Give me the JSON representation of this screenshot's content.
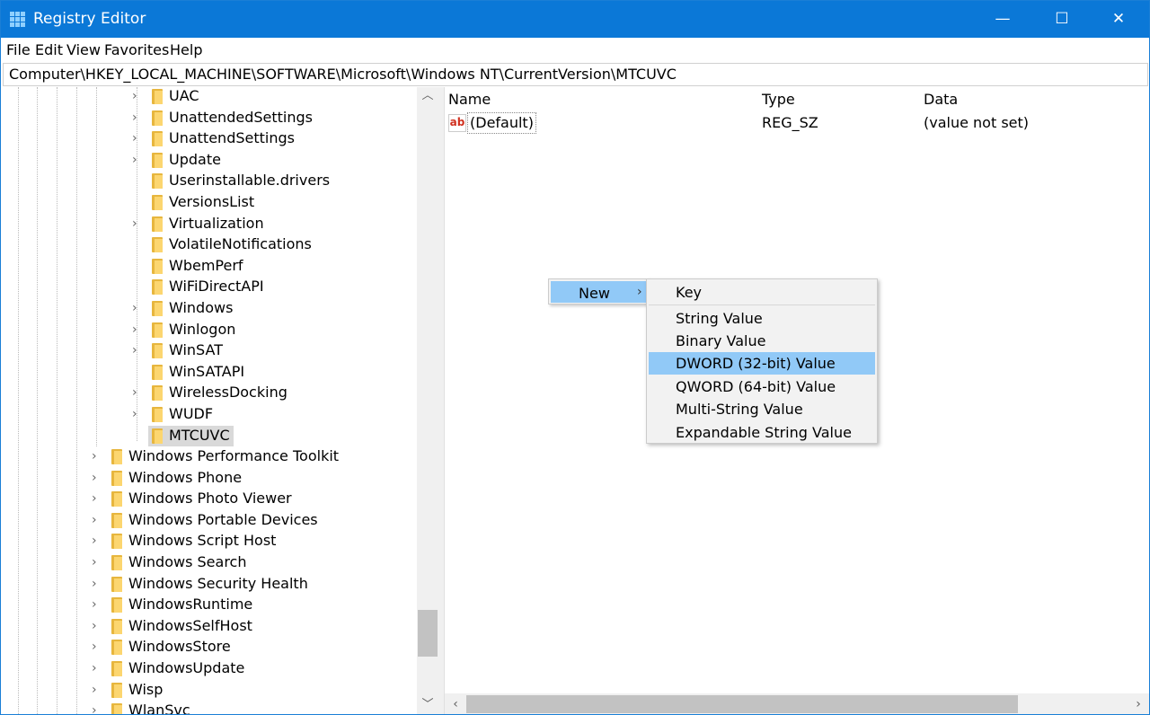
{
  "window": {
    "title": "Registry Editor",
    "minimize": "—",
    "maximize": "☐",
    "close": "✕"
  },
  "menu": [
    "File",
    "Edit",
    "View",
    "Favorites",
    "Help"
  ],
  "address": "Computer\\HKEY_LOCAL_MACHINE\\SOFTWARE\\Microsoft\\Windows NT\\CurrentVersion\\MTCUVC",
  "tree": {
    "sub_items": [
      {
        "label": "UAC",
        "expandable": true
      },
      {
        "label": "UnattendedSettings",
        "expandable": true
      },
      {
        "label": "UnattendSettings",
        "expandable": true
      },
      {
        "label": "Update",
        "expandable": true
      },
      {
        "label": "Userinstallable.drivers",
        "expandable": false
      },
      {
        "label": "VersionsList",
        "expandable": false
      },
      {
        "label": "Virtualization",
        "expandable": true
      },
      {
        "label": "VolatileNotifications",
        "expandable": false
      },
      {
        "label": "WbemPerf",
        "expandable": false
      },
      {
        "label": "WiFiDirectAPI",
        "expandable": false
      },
      {
        "label": "Windows",
        "expandable": true
      },
      {
        "label": "Winlogon",
        "expandable": true
      },
      {
        "label": "WinSAT",
        "expandable": true
      },
      {
        "label": "WinSATAPI",
        "expandable": false
      },
      {
        "label": "WirelessDocking",
        "expandable": true
      },
      {
        "label": "WUDF",
        "expandable": true
      },
      {
        "label": "MTCUVC",
        "expandable": false,
        "selected": true
      }
    ],
    "top_items": [
      {
        "label": "Windows Performance Toolkit",
        "expandable": true
      },
      {
        "label": "Windows Phone",
        "expandable": true
      },
      {
        "label": "Windows Photo Viewer",
        "expandable": true
      },
      {
        "label": "Windows Portable Devices",
        "expandable": true
      },
      {
        "label": "Windows Script Host",
        "expandable": true
      },
      {
        "label": "Windows Search",
        "expandable": true
      },
      {
        "label": "Windows Security Health",
        "expandable": true
      },
      {
        "label": "WindowsRuntime",
        "expandable": true
      },
      {
        "label": "WindowsSelfHost",
        "expandable": true
      },
      {
        "label": "WindowsStore",
        "expandable": true
      },
      {
        "label": "WindowsUpdate",
        "expandable": true
      },
      {
        "label": "Wisp",
        "expandable": true
      },
      {
        "label": "WlanSvc",
        "expandable": true
      }
    ]
  },
  "list": {
    "columns": {
      "name": "Name",
      "type": "Type",
      "data": "Data"
    },
    "rows": [
      {
        "icon": "ab",
        "name": "(Default)",
        "type": "REG_SZ",
        "data": "(value not set)"
      }
    ]
  },
  "context_menu": {
    "parent_label": "New",
    "submenu": [
      "Key",
      "String Value",
      "Binary Value",
      "DWORD (32-bit) Value",
      "QWORD (64-bit) Value",
      "Multi-String Value",
      "Expandable String Value"
    ],
    "highlighted": "DWORD (32-bit) Value"
  },
  "colors": {
    "titlebar": "#0b78d7",
    "highlight": "#91c9f7",
    "folder": "#fcd670"
  }
}
